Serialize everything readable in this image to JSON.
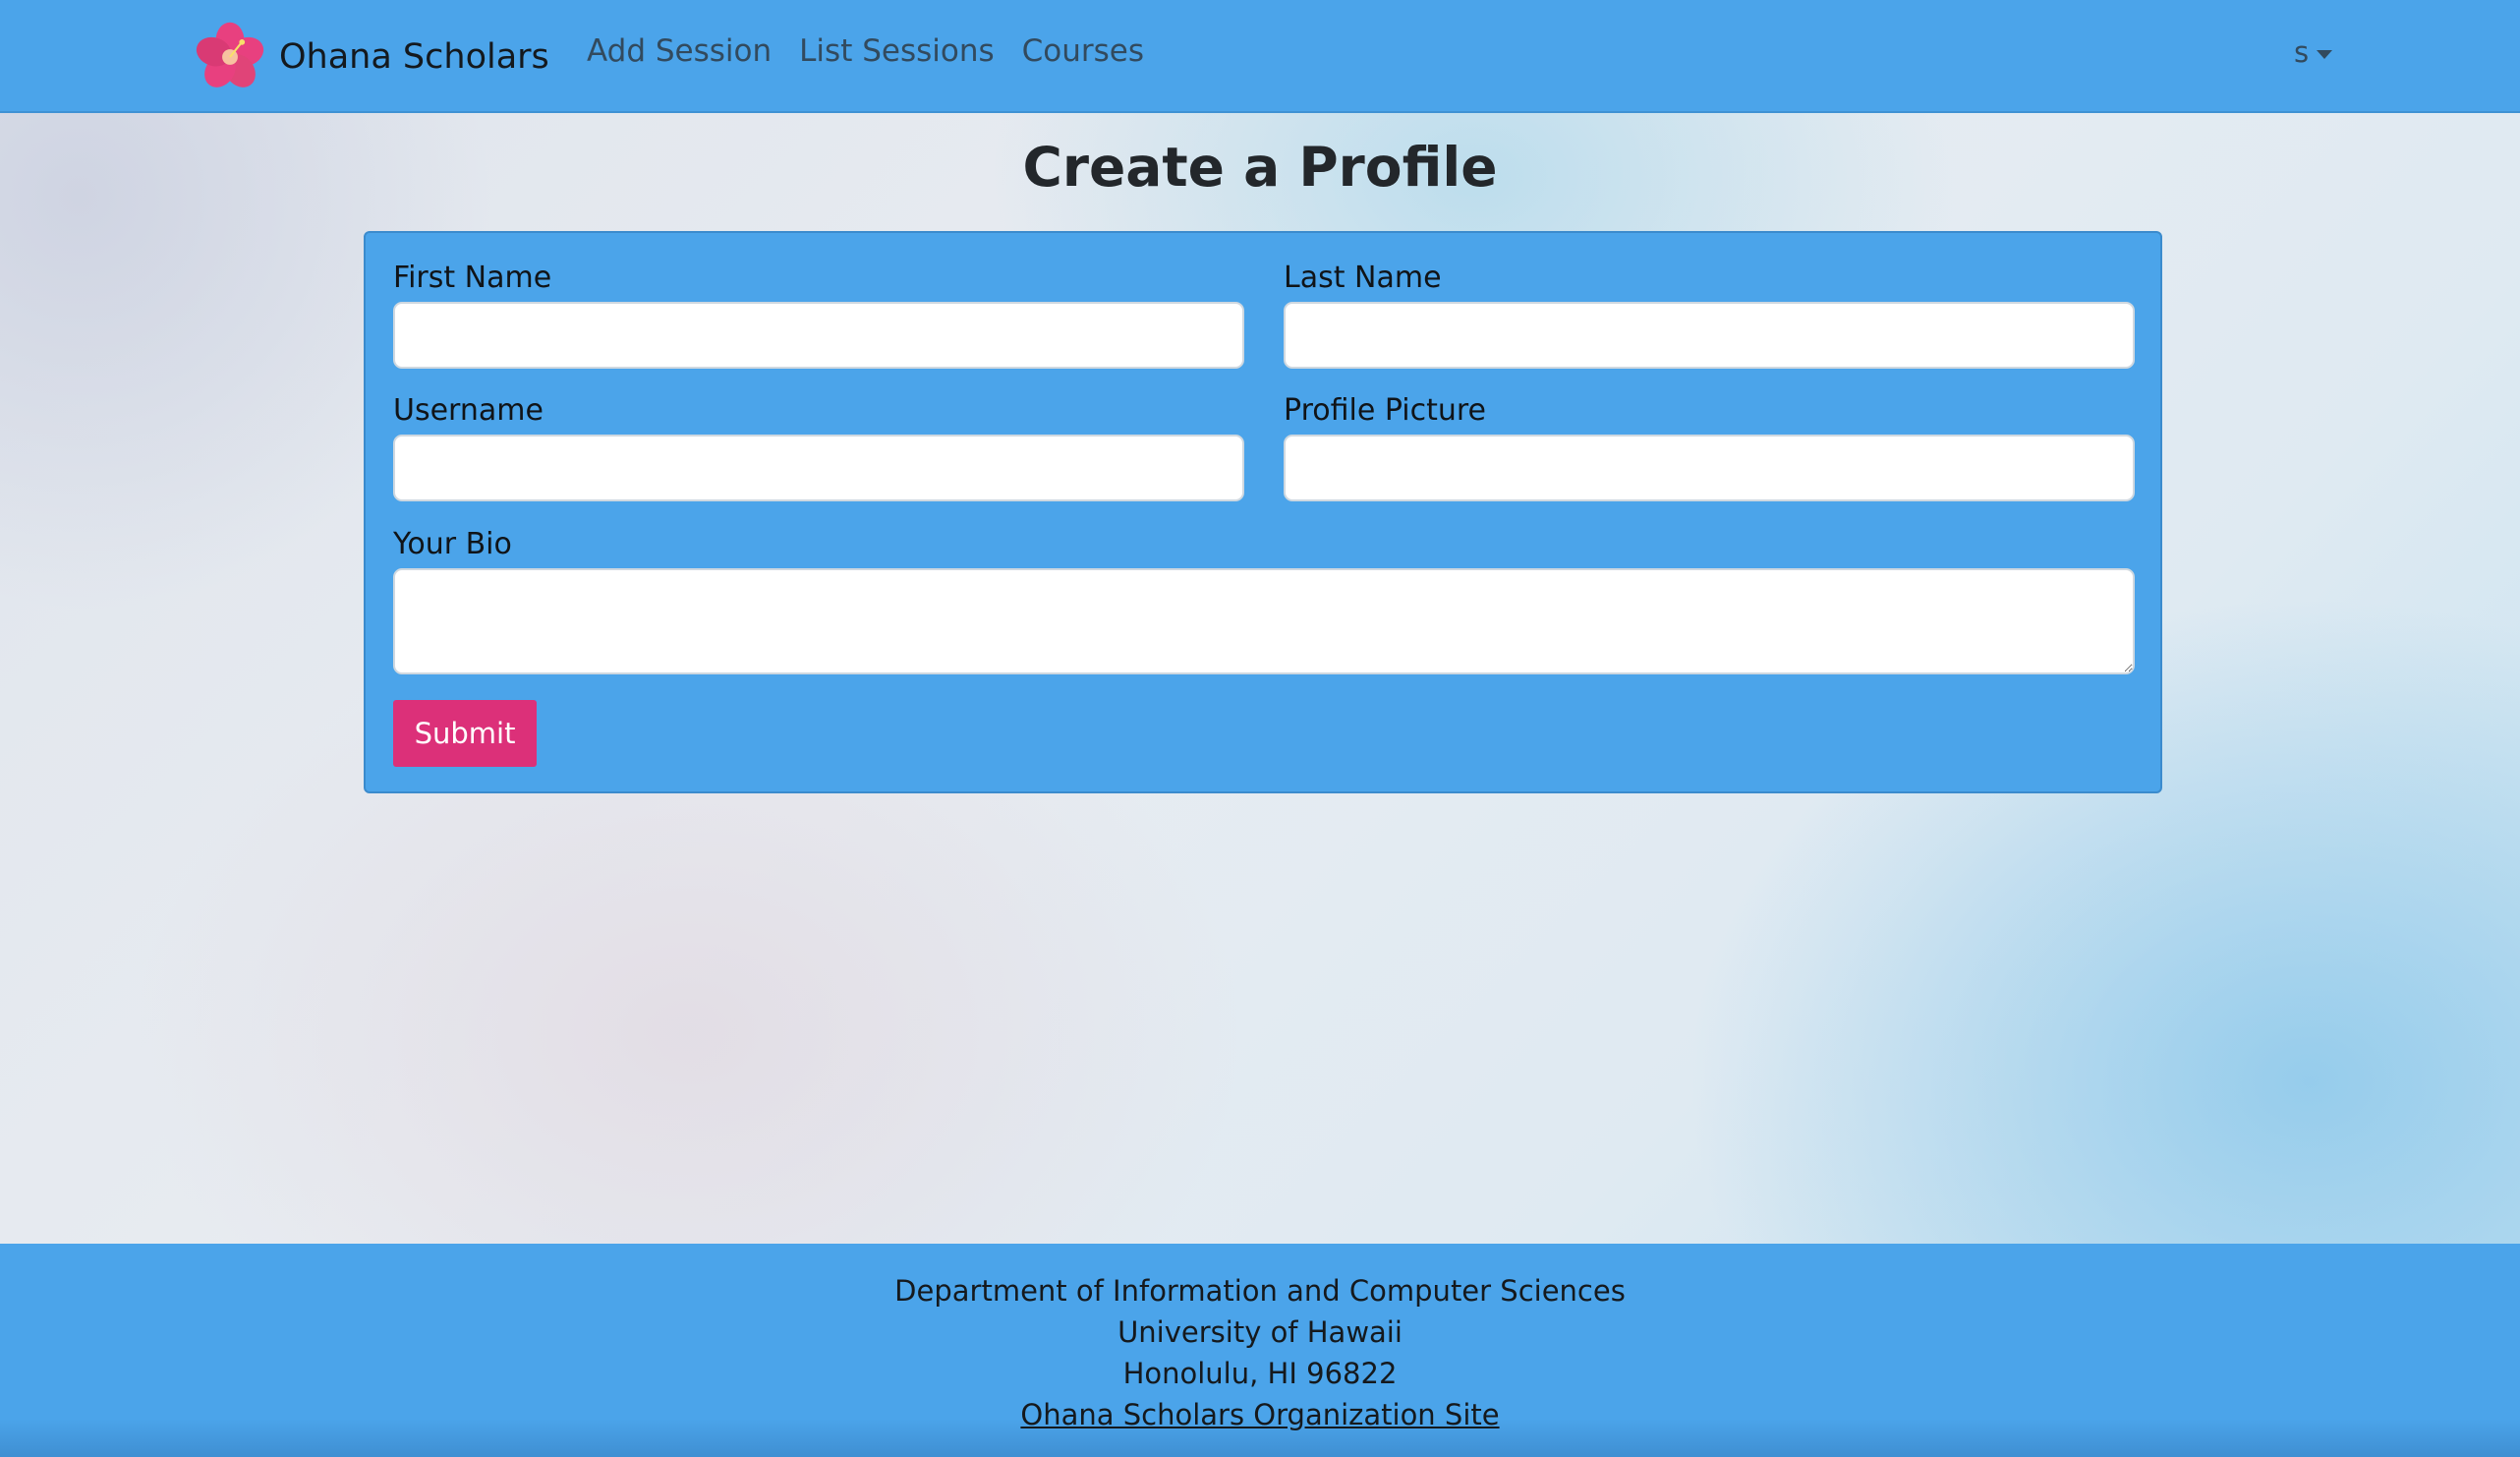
{
  "navbar": {
    "brand_name": "Ohana Scholars",
    "brand_logo_icon": "hibiscus-flower-icon",
    "links": [
      {
        "label": "Add Session"
      },
      {
        "label": "List Sessions"
      },
      {
        "label": "Courses"
      }
    ],
    "user_menu_label": "s"
  },
  "page": {
    "title": "Create a Profile"
  },
  "form": {
    "first_name_label": "First Name",
    "first_name_value": "",
    "last_name_label": "Last Name",
    "last_name_value": "",
    "username_label": "Username",
    "username_value": "",
    "profile_picture_label": "Profile Picture",
    "profile_picture_value": "",
    "bio_label": "Your Bio",
    "bio_value": "",
    "submit_label": "Submit"
  },
  "footer": {
    "line1": "Department of Information and Computer Sciences",
    "line2": "University of Hawaii",
    "line3": "Honolulu, HI 96822",
    "link_label": "Ohana Scholars Organization Site"
  },
  "colors": {
    "primary_blue": "#4ba4ea",
    "accent_pink": "#dc3079"
  }
}
